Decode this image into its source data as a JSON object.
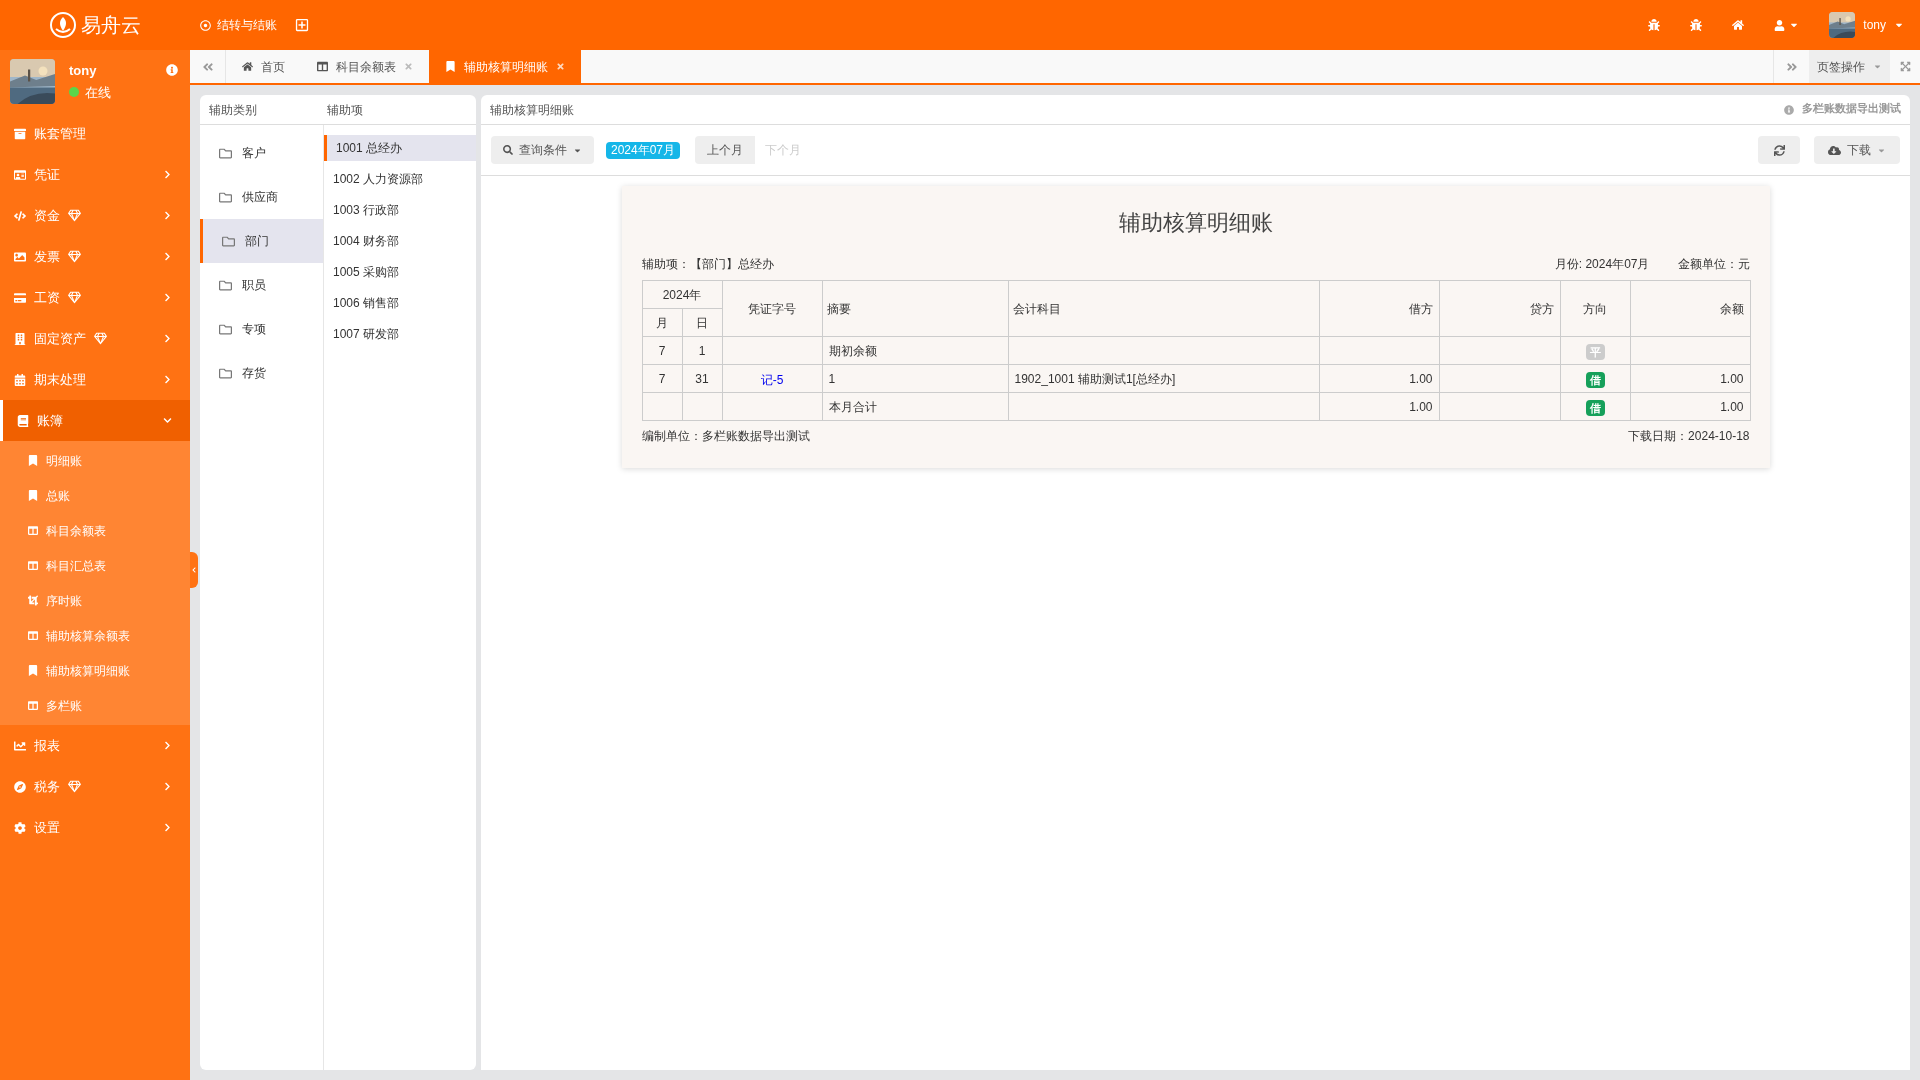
{
  "header": {
    "logo": "易舟云",
    "nav": [
      {
        "label": "结转与结账"
      }
    ],
    "user": "tony"
  },
  "profile": {
    "name": "tony",
    "status": "在线",
    "online": true
  },
  "sidebar": {
    "items": [
      {
        "label": "账套管理",
        "premium": false,
        "selected": false,
        "expandable": false
      },
      {
        "label": "凭证",
        "premium": false,
        "selected": false,
        "expandable": true,
        "expanded": false
      },
      {
        "label": "资金",
        "premium": true,
        "selected": false,
        "expandable": true,
        "expanded": false
      },
      {
        "label": "发票",
        "premium": true,
        "selected": false,
        "expandable": true,
        "expanded": false
      },
      {
        "label": "工资",
        "premium": true,
        "selected": false,
        "expandable": true,
        "expanded": false
      },
      {
        "label": "固定资产",
        "premium": true,
        "selected": false,
        "expandable": true,
        "expanded": false
      },
      {
        "label": "期末处理",
        "premium": false,
        "selected": false,
        "expandable": true,
        "expanded": false
      },
      {
        "label": "账簿",
        "premium": false,
        "selected": true,
        "expandable": true,
        "expanded": true,
        "children": [
          {
            "label": "明细账",
            "selected": false
          },
          {
            "label": "总账",
            "selected": false
          },
          {
            "label": "科目余额表",
            "selected": false
          },
          {
            "label": "科目汇总表",
            "selected": false
          },
          {
            "label": "序时账",
            "selected": false
          },
          {
            "label": "辅助核算余额表",
            "selected": false
          },
          {
            "label": "辅助核算明细账",
            "selected": false
          },
          {
            "label": "多栏账",
            "selected": false
          }
        ]
      },
      {
        "label": "报表",
        "premium": false,
        "selected": false,
        "expandable": true,
        "expanded": false
      },
      {
        "label": "税务",
        "premium": true,
        "selected": false,
        "expandable": true,
        "expanded": false
      },
      {
        "label": "设置",
        "premium": false,
        "selected": false,
        "expandable": true,
        "expanded": false
      }
    ]
  },
  "tabs": [
    {
      "label": "首页",
      "selected": false,
      "closable": false
    },
    {
      "label": "科目余额表",
      "selected": false,
      "closable": true
    },
    {
      "label": "辅助核算明细账",
      "selected": true,
      "closable": true
    }
  ],
  "tab_actions": {
    "label": "页签操作"
  },
  "category_panel": {
    "title": "辅助类别",
    "items": [
      {
        "label": "客户",
        "selected": false
      },
      {
        "label": "供应商",
        "selected": false
      },
      {
        "label": "部门",
        "selected": true
      },
      {
        "label": "职员",
        "selected": false
      },
      {
        "label": "专项",
        "selected": false
      },
      {
        "label": "存货",
        "selected": false
      }
    ]
  },
  "item_panel": {
    "title": "辅助项",
    "items": [
      {
        "label": "1001 总经办",
        "selected": true
      },
      {
        "label": "1002 人力资源部",
        "selected": false
      },
      {
        "label": "1003 行政部",
        "selected": false
      },
      {
        "label": "1004 财务部",
        "selected": false
      },
      {
        "label": "1005 采购部",
        "selected": false
      },
      {
        "label": "1006 销售部",
        "selected": false
      },
      {
        "label": "1007 研发部",
        "selected": false
      }
    ]
  },
  "main": {
    "title": "辅助核算明细账",
    "note": "多栏账数据导出测试",
    "toolbar": {
      "query": "查询条件",
      "period": "2024年07月",
      "prev": {
        "label": "上个月",
        "disabled": false
      },
      "next": {
        "label": "下个月",
        "disabled": true
      },
      "download": "下载"
    },
    "report": {
      "title": "辅助核算明细账",
      "aux_item": "辅助项：【部门】总经办",
      "month": "月份: 2024年07月",
      "unit": "金额单位：元",
      "columns": {
        "year": "2024年",
        "month": "月",
        "day": "日",
        "voucher": "凭证字号",
        "summary": "摘要",
        "account": "会计科目",
        "debit": "借方",
        "credit": "贷方",
        "direction": "方向",
        "balance": "余额"
      },
      "rows": [
        {
          "month": "7",
          "day": "1",
          "voucher": "",
          "summary": "期初余额",
          "account": "",
          "debit": "",
          "credit": "",
          "direction": {
            "text": "平",
            "color": "#cccccc"
          },
          "balance": ""
        },
        {
          "month": "7",
          "day": "31",
          "voucher": "记-5",
          "summary": "1",
          "account": "1902_1001 辅助测试1[总经办]",
          "debit": "1.00",
          "credit": "",
          "direction": {
            "text": "借",
            "color": "#16a05a"
          },
          "balance": "1.00"
        },
        {
          "month": "",
          "day": "",
          "voucher": "",
          "summary": "本月合计",
          "account": "",
          "debit": "1.00",
          "credit": "",
          "direction": {
            "text": "借",
            "color": "#16a05a"
          },
          "balance": "1.00"
        }
      ],
      "maker": "编制单位：多栏账数据导出测试",
      "date": "下载日期：2024-10-18"
    }
  }
}
